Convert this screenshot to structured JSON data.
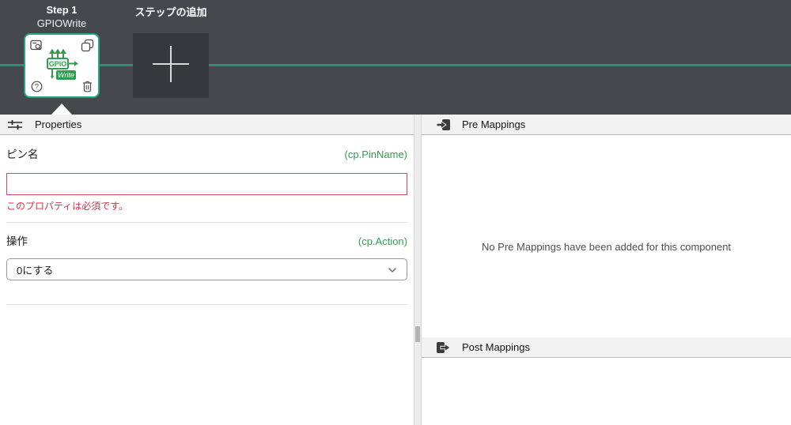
{
  "canvas": {
    "step": {
      "label": "Step 1",
      "type": "GPIOWrite"
    },
    "add_step_label": "ステップの追加",
    "logo": {
      "top_text": "GPIO",
      "bottom_text": "Write"
    },
    "help_glyph": "?"
  },
  "properties_panel": {
    "title": "Properties",
    "fields": [
      {
        "label": "ピン名",
        "binding": "(cp.PinName)",
        "value": "",
        "error": "このプロパティは必須です。"
      },
      {
        "label": "操作",
        "binding": "(cp.Action)",
        "value": "0にする"
      }
    ]
  },
  "pre_mappings_panel": {
    "title": "Pre Mappings",
    "empty_message": "No Pre Mappings have been added for this component"
  },
  "post_mappings_panel": {
    "title": "Post Mappings"
  },
  "colors": {
    "header_dark": "#45494c",
    "add_button_dark": "#35393c",
    "flow_teal": "#2d8f74",
    "card_border_teal": "#2aa47e",
    "binding_green": "#2f9e4e",
    "error_red": "#de2c44",
    "panel_header_gray": "#f1f1f1"
  }
}
